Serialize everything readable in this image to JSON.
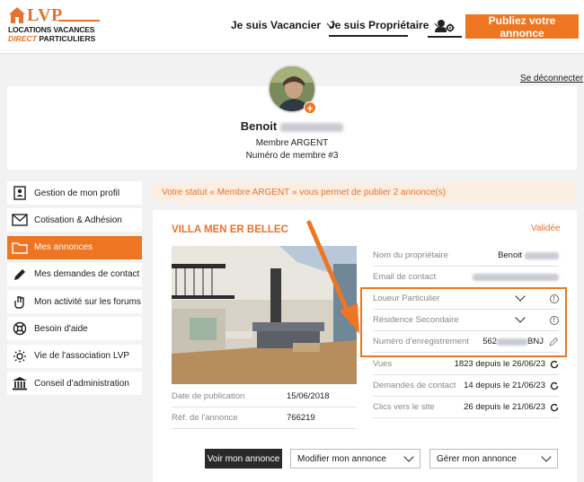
{
  "header": {
    "logo": {
      "brand": "LVP",
      "line1": "LOCATIONS VACANCES",
      "line2_accent": "DIRECT",
      "line2_rest": "PARTICULIERS"
    },
    "nav": [
      {
        "label": "Je suis Vacancier"
      },
      {
        "label": "Je suis Propriétaire"
      }
    ],
    "publish_label": "Publiez votre annonce"
  },
  "profile": {
    "logout_label": "Se déconnecter",
    "first_name": "Benoit",
    "level": "Membre ARGENT",
    "member_number": "Numéro de membre #3"
  },
  "sidebar": {
    "items": [
      {
        "label": "Gestion de mon profil",
        "icon": "id-card-icon"
      },
      {
        "label": "Cotisation & Adhésion",
        "icon": "envelope-icon"
      },
      {
        "label": "Mes annonces",
        "icon": "folder-icon",
        "active": true
      },
      {
        "label": "Mes demandes de contact",
        "icon": "pencil-icon"
      },
      {
        "label": "Mon activité sur les forums",
        "icon": "hand-icon"
      },
      {
        "label": "Besoin d'aide",
        "icon": "lifebuoy-icon"
      },
      {
        "label": "Vie de l'association LVP",
        "icon": "sun-icon"
      },
      {
        "label": "Conseil d'administration",
        "icon": "institution-icon"
      }
    ]
  },
  "status_banner": "Votre statut « Membre ARGENT » vous permet de publier 2 annonce(s)",
  "listing": {
    "title": "VILLA MEN ER BELLEC",
    "status": "Validée",
    "meta": [
      {
        "label": "Date de publication",
        "value": "15/06/2018"
      },
      {
        "label": "Réf. de l'annonce",
        "value": "766219"
      }
    ],
    "owner": {
      "label": "Nom du propriétaire",
      "value": "Benoit"
    },
    "email": {
      "label": "Email de contact"
    },
    "loueur": {
      "label": "Loueur Particulier"
    },
    "residence": {
      "label": "Résidence Secondaire"
    },
    "registration": {
      "label": "Numéro d'enregistrement",
      "value_start": "562",
      "value_end": "BNJ"
    },
    "stats": [
      {
        "label": "Vues",
        "value": "1823 depuis le 26/06/23"
      },
      {
        "label": "Demandes de contact",
        "value": "14 depuis le 21/06/23"
      },
      {
        "label": "Clics vers le site",
        "value": "26 depuis le 21/06/23"
      }
    ],
    "buttons": {
      "view": "Voir mon annonce",
      "modify": "Modifier mon annonce",
      "manage": "Gérer mon annonce"
    }
  },
  "colors": {
    "accent": "#ee7622",
    "banner_bg": "#fbeee3",
    "dark_button": "#2a2a2a"
  }
}
